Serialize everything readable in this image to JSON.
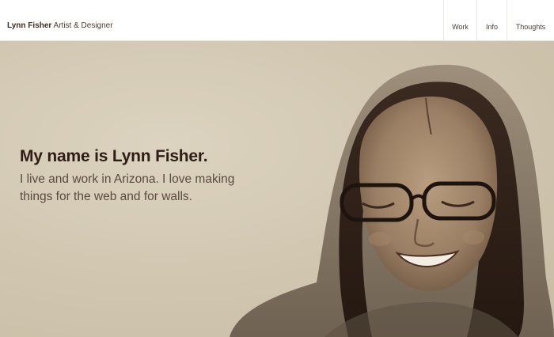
{
  "header": {
    "brand_name": "Lynn Fisher",
    "brand_tagline": "Artist & Designer",
    "nav": [
      {
        "label": "Work"
      },
      {
        "label": "Info"
      },
      {
        "label": "Thoughts"
      }
    ]
  },
  "hero": {
    "title": "My name is Lynn Fisher.",
    "subtitle_line1": "I live and work in Arizona. I love making",
    "subtitle_line2": "things for the web and for walls.",
    "photo_icon": "portrait-photo-icon"
  },
  "colors": {
    "background": "#d2c8b2",
    "text_dark": "#2e1d16",
    "text_sub": "#5a4a40",
    "header_bg": "#ffffff"
  }
}
